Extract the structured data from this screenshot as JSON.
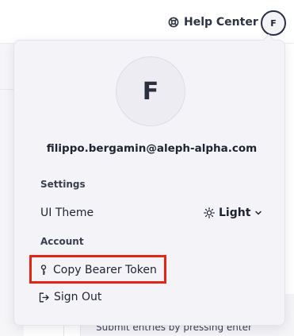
{
  "header": {
    "help_center_label": "Help Center",
    "avatar_initial": "F"
  },
  "background": {
    "hint_text": "Submit entries by pressing enter"
  },
  "profile_menu": {
    "avatar_initial": "F",
    "email": "filippo.bergamin@aleph-alpha.com",
    "settings_section_label": "Settings",
    "ui_theme_label": "UI Theme",
    "theme_value": "Light",
    "account_section_label": "Account",
    "copy_token_label": "Copy Bearer Token",
    "sign_out_label": "Sign Out"
  },
  "icons": {
    "help": "lifebuoy-icon",
    "theme": "sun-icon",
    "dropdown": "chevron-down-icon",
    "token": "key-icon",
    "signout": "sign-out-icon"
  },
  "colors": {
    "highlight_border": "#e32515",
    "menu_background": "#f4f4f8",
    "avatar_ring": "#2b2f45"
  }
}
